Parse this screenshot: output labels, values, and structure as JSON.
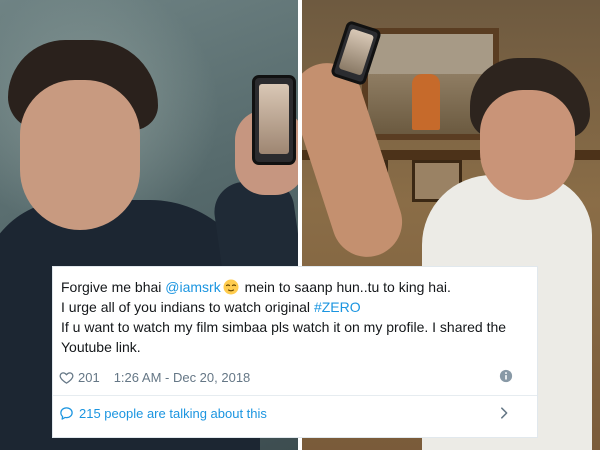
{
  "tweet": {
    "text_part1": "Forgive me bhai ",
    "mention": "@iamsrk",
    "text_part2": " mein to saanp hun..tu to king hai.",
    "line2_prefix": "I urge all of you indians to watch original ",
    "hashtag": "#ZERO",
    "line3": "If u want to watch my film simbaa pls watch it on my profile. I shared the Youtube link.",
    "likes": "201",
    "timestamp": "1:26 AM - Dec 20, 2018",
    "talking": "215 people are talking about this"
  },
  "icons": {
    "emoji": "relieved-face-icon",
    "like": "heart-outline-icon",
    "info": "info-circle-icon",
    "talking": "speech-bubble-icon",
    "chevron": "chevron-right-icon"
  },
  "colors": {
    "link": "#1b95e0",
    "text": "#14171a",
    "meta": "#657786",
    "emoji_face": "#ffcc4d"
  }
}
